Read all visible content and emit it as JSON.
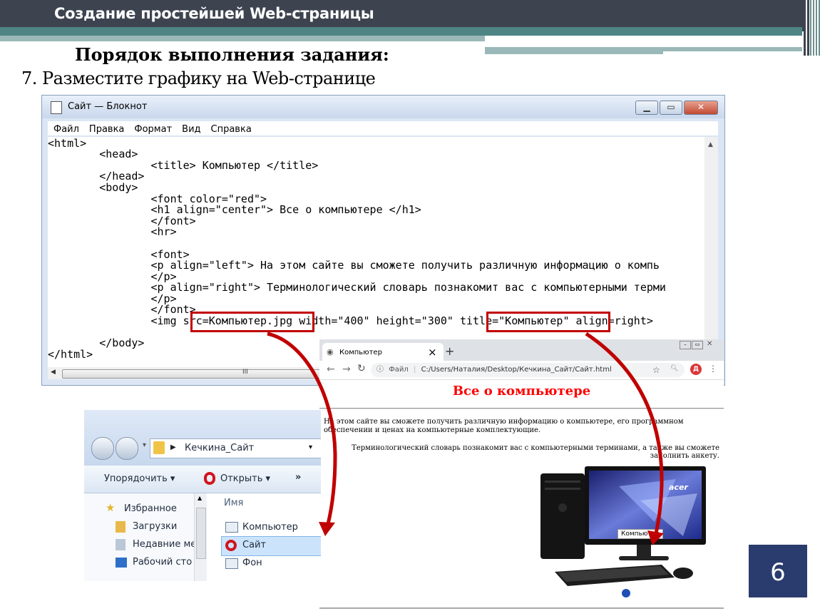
{
  "slide": {
    "title": "Создание простейшей Web-страницы",
    "heading": "Порядок выполнения задания:",
    "step": "7. Разместите графику на Web-странице",
    "page_number": "6"
  },
  "notepad": {
    "title": "Сайт — Блокнот",
    "menu": [
      "Файл",
      "Правка",
      "Формат",
      "Вид",
      "Справка"
    ],
    "lines": [
      "<html>",
      "        <head>",
      "                <title> Компьютер </title>",
      "        </head>",
      "        <body>",
      "",
      "                <font color=\"red\">",
      "                <h1 align=\"center\"> Все о компьютере </h1>",
      "                </font>",
      "                <hr>",
      "",
      "                <font>",
      "                <p align=\"left\"> На этом сайте вы сможете получить различную информацию о компь",
      "                </p>",
      "                <p align=\"right\"> Терминологический словарь познакомит вас с компьютерными терми",
      "                </p>",
      "                </font>",
      "                <img src=Компьютер.jpg width=\"400\" height=\"300\" title=\"Компьютер\" align=right>",
      "",
      "        </body>",
      "</html>"
    ],
    "scroll_mark": "III"
  },
  "browser": {
    "tab_title": "Компьютер",
    "url_prefix": "Файл",
    "url": "C:/Users/Наталия/Desktop/Кечкина_Сайт/Сайт.html",
    "avatar": "Д",
    "h1": "Все о компьютере",
    "p_left": "На этом сайте вы сможете получить различную информацию о компьютере, его программном обеспечении и ценах на компьютерные комплектующие.",
    "p_right": "Терминологический словарь познакомит вас с компьютерными терминами, а также вы сможете заполнить анкету.",
    "tooltip": "Компьютер",
    "monitor_brand": "acer"
  },
  "explorer": {
    "path": "Кечкина_Сайт",
    "organize": "Упорядочить",
    "open": "Открыть",
    "more": "»",
    "nav": [
      "Избранное",
      "Загрузки",
      "Недавние ме",
      "Рабочий сто"
    ],
    "column": "Имя",
    "files": [
      "Компьютер",
      "Сайт",
      "Фон"
    ]
  },
  "colors": {
    "accent": "#c00000",
    "header": "#3d4450",
    "band": "#4e8584",
    "page_badge": "#2a3b6e"
  }
}
